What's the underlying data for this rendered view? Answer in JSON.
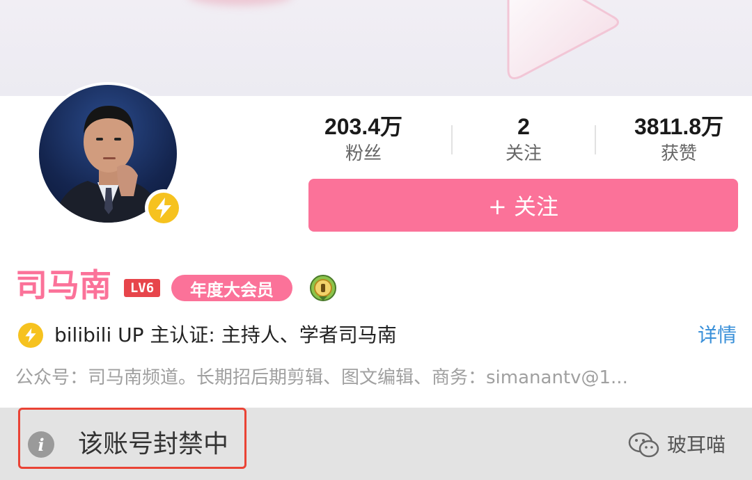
{
  "profile": {
    "name": "司马南",
    "level": "LV6",
    "vip_label": "年度大会员"
  },
  "stats": {
    "followers": {
      "value": "203.4万",
      "label": "粉丝"
    },
    "following": {
      "value": "2",
      "label": "关注"
    },
    "likes": {
      "value": "3811.8万",
      "label": "获赞"
    }
  },
  "follow_button": {
    "label": "+ 关注"
  },
  "certification": {
    "text": "bilibili UP 主认证: 主持人、学者司马南",
    "detail_label": "详情"
  },
  "bio": "公众号：司马南频道。长期招后期剪辑、图文编辑、商务：simanantv@1...",
  "notice": {
    "text": "该账号封禁中"
  },
  "watermark": {
    "text": "玻耳喵"
  },
  "colors": {
    "accent_pink": "#fb7299",
    "level_red": "#e7454b",
    "link_blue": "#3a90d9",
    "badge_yellow": "#f6c21f",
    "highlight_red": "#ea4335"
  },
  "icons": {
    "verify": "lightning-badge-icon",
    "info": "info-icon",
    "medal": "medal-icon",
    "watermark": "wechat-icon"
  }
}
